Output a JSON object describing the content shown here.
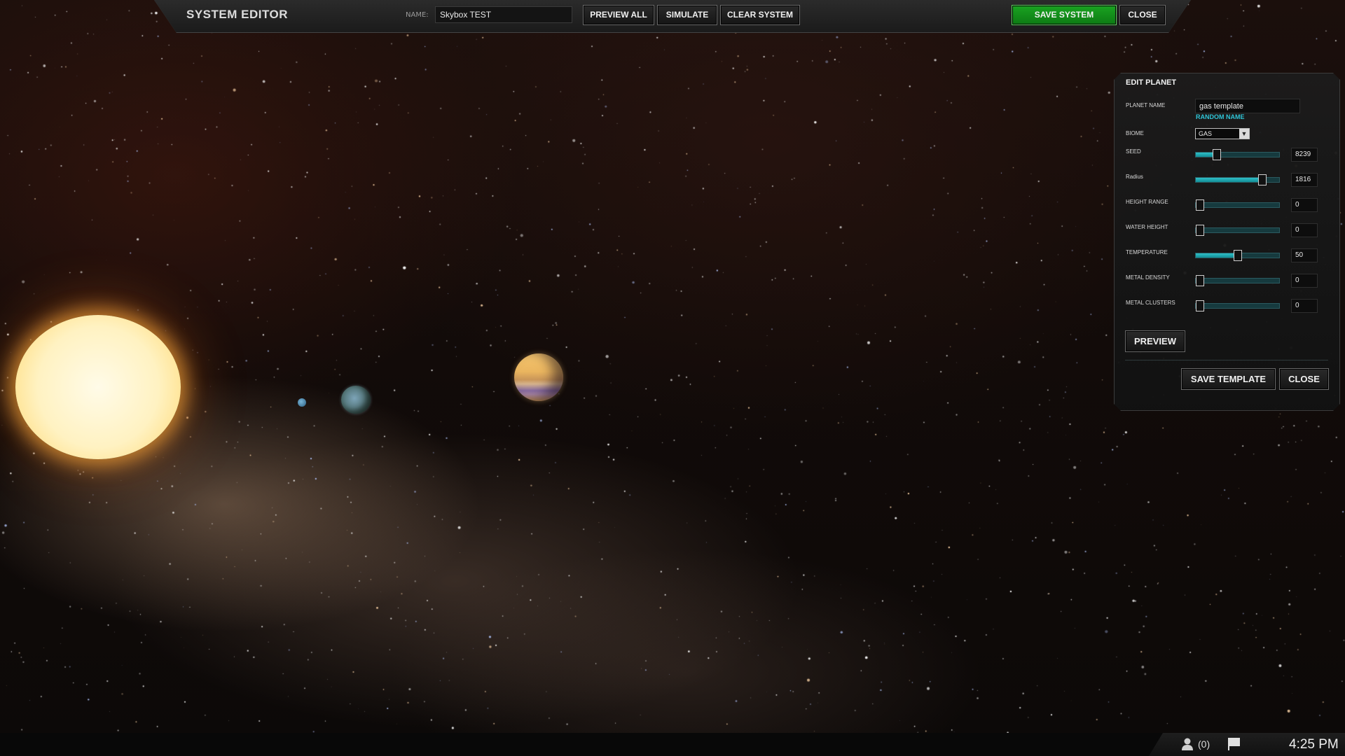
{
  "topbar": {
    "title": "SYSTEM EDITOR",
    "name_label": "NAME:",
    "name_value": "Skybox TEST",
    "buttons": {
      "preview_all": "PREVIEW ALL",
      "simulate": "SIMULATE",
      "clear_system": "CLEAR SYSTEM",
      "save_system": "SAVE SYSTEM",
      "close": "CLOSE"
    }
  },
  "edit_planet": {
    "title": "EDIT PLANET",
    "planet_name_label": "PLANET NAME",
    "planet_name_value": "gas template",
    "random_name": "RANDOM NAME",
    "biome_label": "BIOME",
    "biome_value": "GAS",
    "sliders": [
      {
        "label": "SEED",
        "value": "8239",
        "level": 0.25
      },
      {
        "label": "Radius",
        "value": "1816",
        "level": 0.8
      },
      {
        "label": "HEIGHT RANGE",
        "value": "0",
        "level": 0
      },
      {
        "label": "WATER HEIGHT",
        "value": "0",
        "level": 0
      },
      {
        "label": "TEMPERATURE",
        "value": "50",
        "level": 0.5
      },
      {
        "label": "METAL DENSITY",
        "value": "0",
        "level": 0
      },
      {
        "label": "METAL CLUSTERS",
        "value": "0",
        "level": 0
      }
    ],
    "preview": "PREVIEW",
    "save_template": "SAVE TEMPLATE",
    "close": "CLOSE"
  },
  "taskbar": {
    "players_count": "(0)",
    "clock": "4:25 PM"
  },
  "colors": {
    "accent": "#2ec4d6",
    "save_green": "#16961e"
  }
}
